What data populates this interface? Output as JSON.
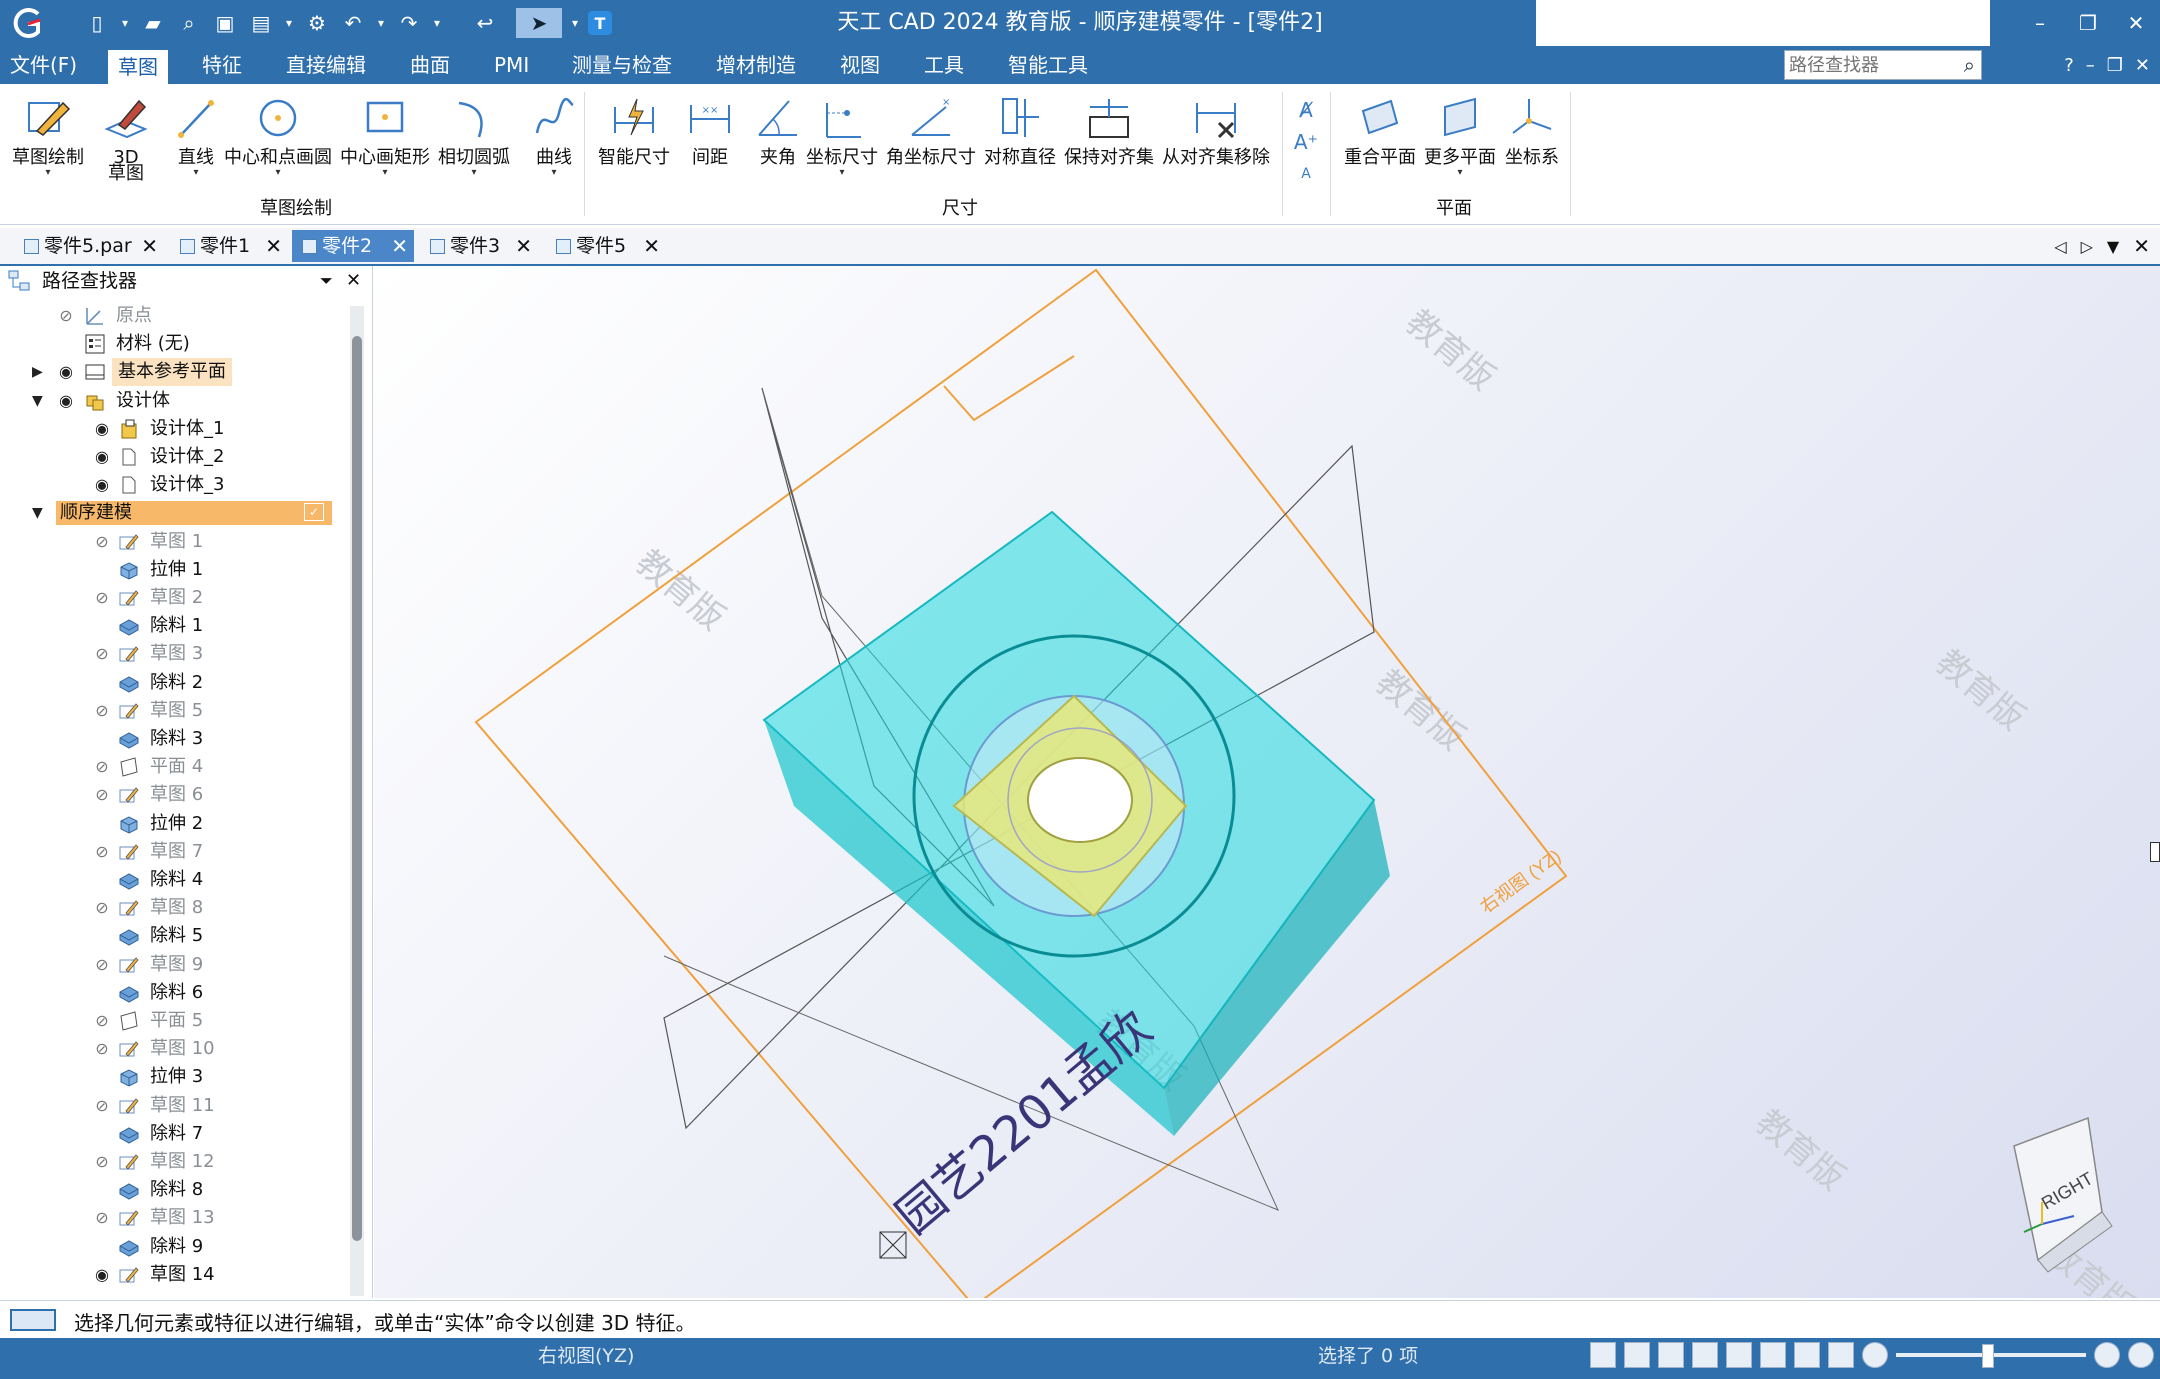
{
  "app": {
    "title": "天工 CAD 2024 教育版 - 顺序建模零件 - [零件2]"
  },
  "quick_access": [
    "new-icon",
    "dropdown-icon",
    "open-icon",
    "print-preview-icon",
    "save-icon",
    "save-all-icon",
    "dropdown-icon",
    "settings-icon",
    "undo-icon",
    "redo-icon",
    "back-icon",
    "select-arrow-icon",
    "dropdown-icon",
    "text-tool-icon"
  ],
  "window_controls": {
    "minimize": "–",
    "restore": "❐",
    "close": "✕"
  },
  "menu": {
    "items": [
      {
        "label": "文件(F)"
      },
      {
        "label": "草图"
      },
      {
        "label": "特征"
      },
      {
        "label": "直接编辑"
      },
      {
        "label": "曲面"
      },
      {
        "label": "PMI"
      },
      {
        "label": "测量与检查"
      },
      {
        "label": "增材制造"
      },
      {
        "label": "视图"
      },
      {
        "label": "工具"
      },
      {
        "label": "智能工具"
      }
    ],
    "active_index": 1,
    "search_placeholder": "路径查找器",
    "help": "?",
    "sub_min": "–",
    "sub_restore": "❐",
    "sub_close": "✕"
  },
  "ribbon": {
    "tools": [
      {
        "label": "草图绘制",
        "icon": "sketch-draw-icon"
      },
      {
        "label": "3D",
        "label2": "草图",
        "icon": "sketch-3d-icon"
      },
      {
        "label": "直线",
        "icon": "line-icon"
      },
      {
        "label": "中心和点画圆",
        "icon": "circle-icon"
      },
      {
        "label": "中心画矩形",
        "icon": "rectangle-icon"
      },
      {
        "label": "相切圆弧",
        "icon": "arc-icon"
      },
      {
        "label": "曲线",
        "icon": "curve-icon"
      },
      {
        "label": "智能尺寸",
        "icon": "smart-dimension-icon"
      },
      {
        "label": "间距",
        "icon": "distance-icon"
      },
      {
        "label": "夹角",
        "icon": "angle-icon"
      },
      {
        "label": "坐标尺寸",
        "icon": "coordinate-dimension-icon"
      },
      {
        "label": "角坐标尺寸",
        "icon": "angular-coordinate-icon"
      },
      {
        "label": "对称直径",
        "icon": "symmetric-diameter-icon"
      },
      {
        "label": "保持对齐集",
        "icon": "keep-alignment-icon"
      },
      {
        "label": "从对齐集移除",
        "icon": "remove-alignment-icon"
      },
      {
        "label": "重合平面",
        "icon": "coincident-plane-icon"
      },
      {
        "label": "更多平面",
        "icon": "more-planes-icon"
      },
      {
        "label": "坐标系",
        "icon": "coordinate-system-icon"
      }
    ],
    "groups": [
      {
        "label": "草图绘制"
      },
      {
        "label": "尺寸"
      },
      {
        "label": "平面"
      }
    ]
  },
  "doc_tabs": [
    {
      "label": "零件5.par"
    },
    {
      "label": "零件1"
    },
    {
      "label": "零件2"
    },
    {
      "label": "零件3"
    },
    {
      "label": "零件5"
    }
  ],
  "active_tab": 2,
  "pathfinder": {
    "title": "路径查找器",
    "items": [
      {
        "label": "原点",
        "level": 1,
        "eye": "hidden",
        "icon": "origin-icon",
        "dim": true
      },
      {
        "label": "材料 (无)",
        "level": 1,
        "eye": "none",
        "icon": "material-icon"
      },
      {
        "label": "基本参考平面",
        "level": 1,
        "eye": "visible",
        "icon": "reference-plane-icon",
        "expander": "▶",
        "highlight": true
      },
      {
        "label": "设计体",
        "level": 1,
        "eye": "visible",
        "icon": "design-body-icon",
        "expander": "▼"
      },
      {
        "label": "设计体_1",
        "level": 2,
        "eye": "visible",
        "icon": "body-icon"
      },
      {
        "label": "设计体_2",
        "level": 2,
        "eye": "visible",
        "icon": "body-outline-icon"
      },
      {
        "label": "设计体_3",
        "level": 2,
        "eye": "visible",
        "icon": "body-outline-icon"
      },
      {
        "label": "顺序建模",
        "level": 0,
        "eye": "none",
        "icon": "none",
        "expander": "▼",
        "banner": true
      },
      {
        "label": "草图 1",
        "level": 2,
        "eye": "hidden",
        "icon": "sketch-icon",
        "dim": true
      },
      {
        "label": "拉伸 1",
        "level": 2,
        "eye": "none",
        "icon": "extrude-icon"
      },
      {
        "label": "草图 2",
        "level": 2,
        "eye": "hidden",
        "icon": "sketch-icon",
        "dim": true
      },
      {
        "label": "除料 1",
        "level": 2,
        "eye": "none",
        "icon": "cut-icon"
      },
      {
        "label": "草图 3",
        "level": 2,
        "eye": "hidden",
        "icon": "sketch-icon",
        "dim": true
      },
      {
        "label": "除料 2",
        "level": 2,
        "eye": "none",
        "icon": "cut-icon"
      },
      {
        "label": "草图 5",
        "level": 2,
        "eye": "hidden",
        "icon": "sketch-icon",
        "dim": true
      },
      {
        "label": "除料 3",
        "level": 2,
        "eye": "none",
        "icon": "cut-icon"
      },
      {
        "label": "平面 4",
        "level": 2,
        "eye": "hidden",
        "icon": "plane-icon",
        "dim": true
      },
      {
        "label": "草图 6",
        "level": 2,
        "eye": "hidden",
        "icon": "sketch-icon",
        "dim": true
      },
      {
        "label": "拉伸 2",
        "level": 2,
        "eye": "none",
        "icon": "extrude-icon"
      },
      {
        "label": "草图 7",
        "level": 2,
        "eye": "hidden",
        "icon": "sketch-icon",
        "dim": true
      },
      {
        "label": "除料 4",
        "level": 2,
        "eye": "none",
        "icon": "cut-icon"
      },
      {
        "label": "草图 8",
        "level": 2,
        "eye": "hidden",
        "icon": "sketch-icon",
        "dim": true
      },
      {
        "label": "除料 5",
        "level": 2,
        "eye": "none",
        "icon": "cut-icon"
      },
      {
        "label": "草图 9",
        "level": 2,
        "eye": "hidden",
        "icon": "sketch-icon",
        "dim": true
      },
      {
        "label": "除料 6",
        "level": 2,
        "eye": "none",
        "icon": "cut-icon"
      },
      {
        "label": "平面 5",
        "level": 2,
        "eye": "hidden",
        "icon": "plane-icon",
        "dim": true
      },
      {
        "label": "草图 10",
        "level": 2,
        "eye": "hidden",
        "icon": "sketch-icon",
        "dim": true
      },
      {
        "label": "拉伸 3",
        "level": 2,
        "eye": "none",
        "icon": "extrude-icon"
      },
      {
        "label": "草图 11",
        "level": 2,
        "eye": "hidden",
        "icon": "sketch-icon",
        "dim": true
      },
      {
        "label": "除料 7",
        "level": 2,
        "eye": "none",
        "icon": "cut-icon"
      },
      {
        "label": "草图 12",
        "level": 2,
        "eye": "hidden",
        "icon": "sketch-icon",
        "dim": true
      },
      {
        "label": "除料 8",
        "level": 2,
        "eye": "none",
        "icon": "cut-icon"
      },
      {
        "label": "草图 13",
        "level": 2,
        "eye": "hidden",
        "icon": "sketch-icon",
        "dim": true
      },
      {
        "label": "除料 9",
        "level": 2,
        "eye": "none",
        "icon": "cut-icon"
      },
      {
        "label": "草图 14",
        "level": 2,
        "eye": "visible",
        "icon": "sketch-icon"
      }
    ]
  },
  "viewport": {
    "watermark": "教育版",
    "plane_label": "右视图 (YZ)",
    "sketch_text": "园艺2201孟欣",
    "view_cube_label": "RIGHT"
  },
  "status": {
    "prompt": "选择几何元素或特征以进行编辑，或单击“实体”命令以创建 3D 特征。",
    "view_name": "右视图(YZ)",
    "selection": "选择了 0 项"
  },
  "colors": {
    "title_bar": "#2f6fab",
    "part_cyan": "#1fd8df",
    "part_yellow": "#e6e67a",
    "plane_orange": "#f0a03c"
  }
}
